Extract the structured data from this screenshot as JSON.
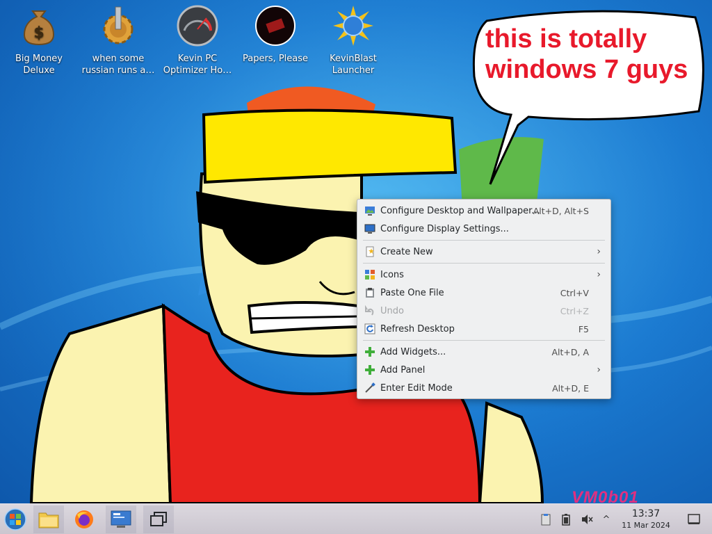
{
  "desktop": {
    "icons": [
      {
        "label": "Big Money\nDeluxe",
        "icon": "money-bag-icon"
      },
      {
        "label": "when some\nrussian runs a…",
        "icon": "gear-icon"
      },
      {
        "label": "Kevin PC\nOptimizer Ho…",
        "icon": "gauge-icon"
      },
      {
        "label": "Papers, Please",
        "icon": "stamp-icon"
      },
      {
        "label": "KevinBlast\nLauncher",
        "icon": "starburst-globe-icon"
      }
    ],
    "bubble_text": "this is totally\nwindows 7 guys",
    "watermark": "VM0b01"
  },
  "context_menu": {
    "items": [
      {
        "label": "Configure Desktop and Wallpaper...",
        "shortcut": "Alt+D, Alt+S",
        "icon": "configure-desktop-icon"
      },
      {
        "label": "Configure Display Settings...",
        "shortcut": "",
        "icon": "display-settings-icon"
      },
      {
        "label": "Create New",
        "shortcut": "",
        "icon": "create-new-icon",
        "submenu": true
      },
      {
        "label": "Icons",
        "shortcut": "",
        "icon": "icons-icon",
        "submenu": true
      },
      {
        "label": "Paste One File",
        "shortcut": "Ctrl+V",
        "icon": "paste-icon"
      },
      {
        "label": "Undo",
        "shortcut": "Ctrl+Z",
        "icon": "undo-icon",
        "disabled": true
      },
      {
        "label": "Refresh Desktop",
        "shortcut": "F5",
        "icon": "refresh-icon"
      },
      {
        "label": "Add Widgets...",
        "shortcut": "Alt+D, A",
        "icon": "add-icon"
      },
      {
        "label": "Add Panel",
        "shortcut": "",
        "icon": "add-icon",
        "submenu": true
      },
      {
        "label": "Enter Edit Mode",
        "shortcut": "Alt+D, E",
        "icon": "edit-mode-icon"
      }
    ],
    "submenu_arrow": "›"
  },
  "taskbar": {
    "buttons": [
      {
        "name": "start-button",
        "icon": "windows-orb-icon"
      },
      {
        "name": "file-manager-button",
        "icon": "folder-icon"
      },
      {
        "name": "firefox-button",
        "icon": "firefox-icon"
      },
      {
        "name": "system-settings-button",
        "icon": "settings-icon"
      },
      {
        "name": "window-switcher-button",
        "icon": "windows-overview-icon"
      }
    ],
    "tray": {
      "clipboard": "clipboard-icon",
      "battery": "battery-icon",
      "volume": "volume-muted-icon",
      "expand_arrow": "^"
    },
    "clock": {
      "time": "13:37",
      "date": "11 Mar 2024"
    },
    "show_desktop": "show-desktop-icon"
  },
  "colors": {
    "bubble_text": "#e8192b",
    "menu_bg": "#eff0f1",
    "taskbar_bg": "#d6d2da"
  }
}
